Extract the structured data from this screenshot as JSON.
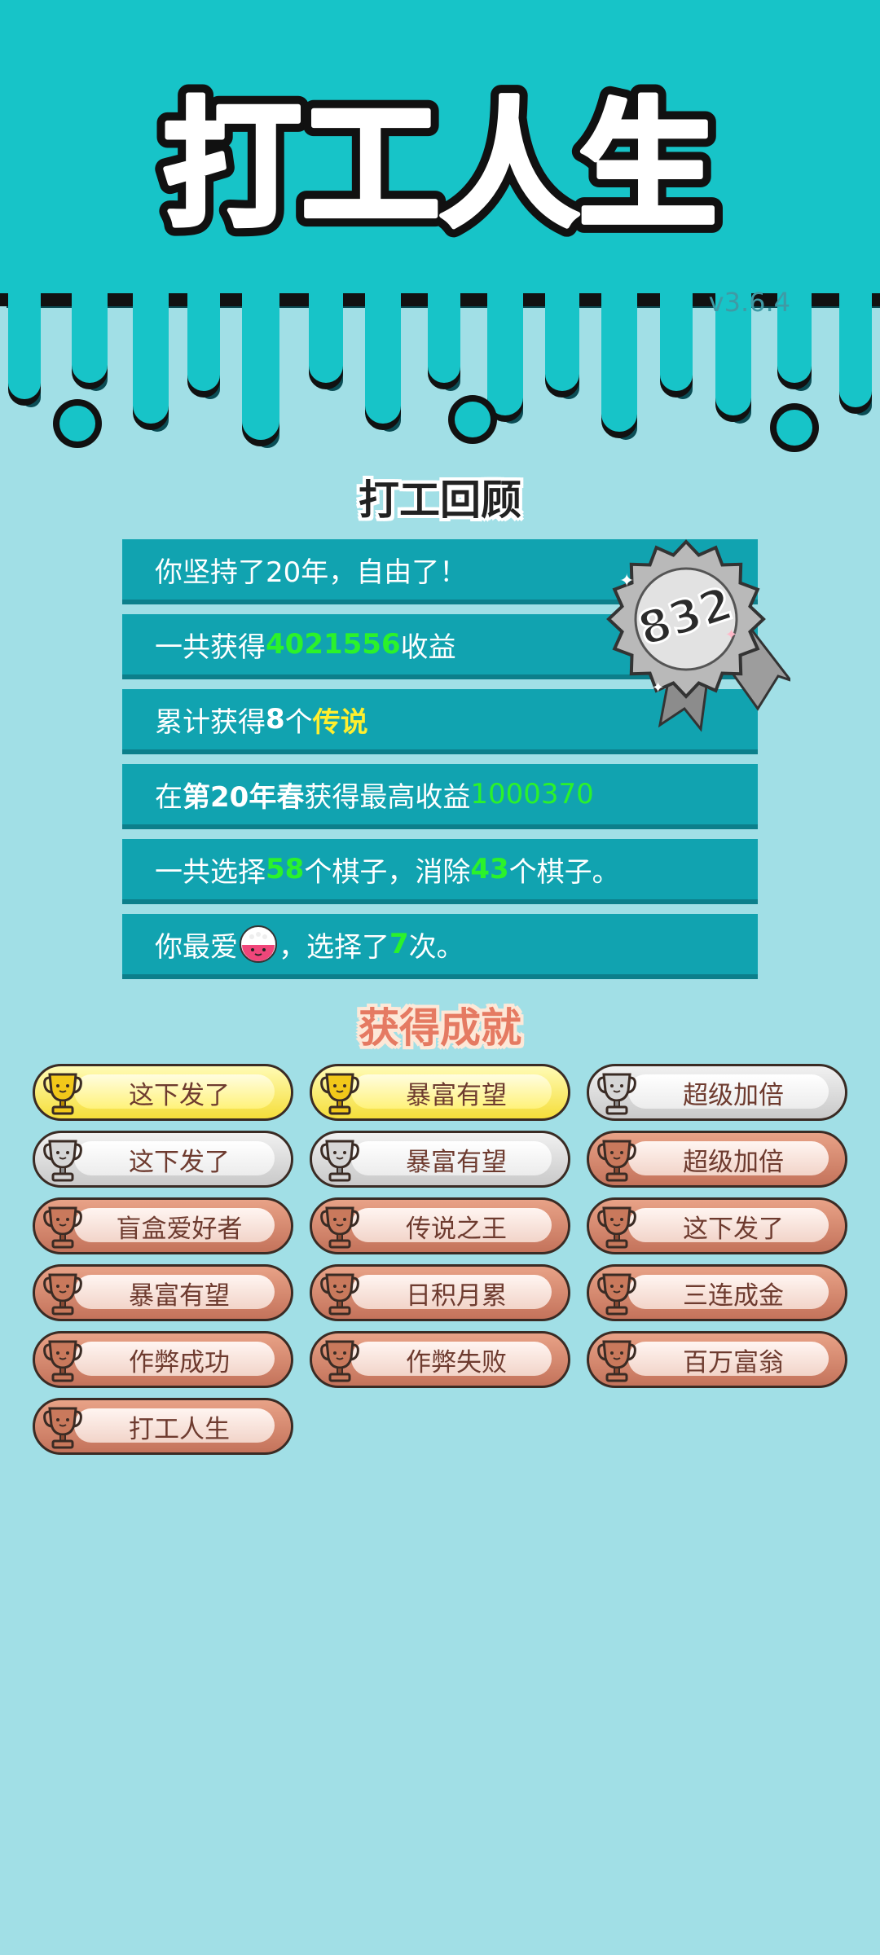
{
  "app": {
    "title": "打工人生",
    "version": "v3.6.4"
  },
  "review": {
    "title": "打工回顾",
    "score": "832",
    "rows": [
      {
        "parts": [
          {
            "t": "你坚持了20年，自由了！"
          }
        ]
      },
      {
        "parts": [
          {
            "t": "一共获得"
          },
          {
            "t": "4021556",
            "c": "hl-green"
          },
          {
            "t": "收益"
          }
        ]
      },
      {
        "parts": [
          {
            "t": "累计获得"
          },
          {
            "t": "8",
            "c": "bold"
          },
          {
            "t": "个"
          },
          {
            "t": "传说",
            "c": "hl-yellow"
          }
        ]
      },
      {
        "parts": [
          {
            "t": "在 "
          },
          {
            "t": "第20年春",
            "c": "bold"
          },
          {
            "t": " 获得最高收益"
          },
          {
            "t": "1000370",
            "c": "hl-green-thin"
          }
        ]
      },
      {
        "parts": [
          {
            "t": "一共选择"
          },
          {
            "t": "58",
            "c": "hl-green"
          },
          {
            "t": "个棋子，消除"
          },
          {
            "t": "43",
            "c": "hl-green"
          },
          {
            "t": "个棋子。"
          }
        ]
      },
      {
        "parts": [
          {
            "t": "你最爱"
          },
          {
            "icon": "rice-bowl-icon"
          },
          {
            "t": "，选择了"
          },
          {
            "t": "7",
            "c": "hl-green"
          },
          {
            "t": "次。"
          }
        ]
      }
    ]
  },
  "achievements": {
    "title": "获得成就",
    "items": [
      {
        "label": "这下发了",
        "tier": "gold"
      },
      {
        "label": "暴富有望",
        "tier": "gold"
      },
      {
        "label": "超级加倍",
        "tier": "silver"
      },
      {
        "label": "这下发了",
        "tier": "silver"
      },
      {
        "label": "暴富有望",
        "tier": "silver"
      },
      {
        "label": "超级加倍",
        "tier": "bronze"
      },
      {
        "label": "盲盒爱好者",
        "tier": "bronze"
      },
      {
        "label": "传说之王",
        "tier": "bronze"
      },
      {
        "label": "这下发了",
        "tier": "bronze"
      },
      {
        "label": "暴富有望",
        "tier": "bronze"
      },
      {
        "label": "日积月累",
        "tier": "bronze"
      },
      {
        "label": "三连成金",
        "tier": "bronze"
      },
      {
        "label": "作弊成功",
        "tier": "bronze"
      },
      {
        "label": "作弊失败",
        "tier": "bronze"
      },
      {
        "label": "百万富翁",
        "tier": "bronze"
      },
      {
        "label": "打工人生",
        "tier": "bronze"
      }
    ]
  },
  "colors": {
    "header_bg": "#17c4c8",
    "page_bg": "#a1dfe6",
    "row_bg": "#11a3b0",
    "highlight_green": "#2bf22b",
    "highlight_yellow": "#ffef2e"
  }
}
